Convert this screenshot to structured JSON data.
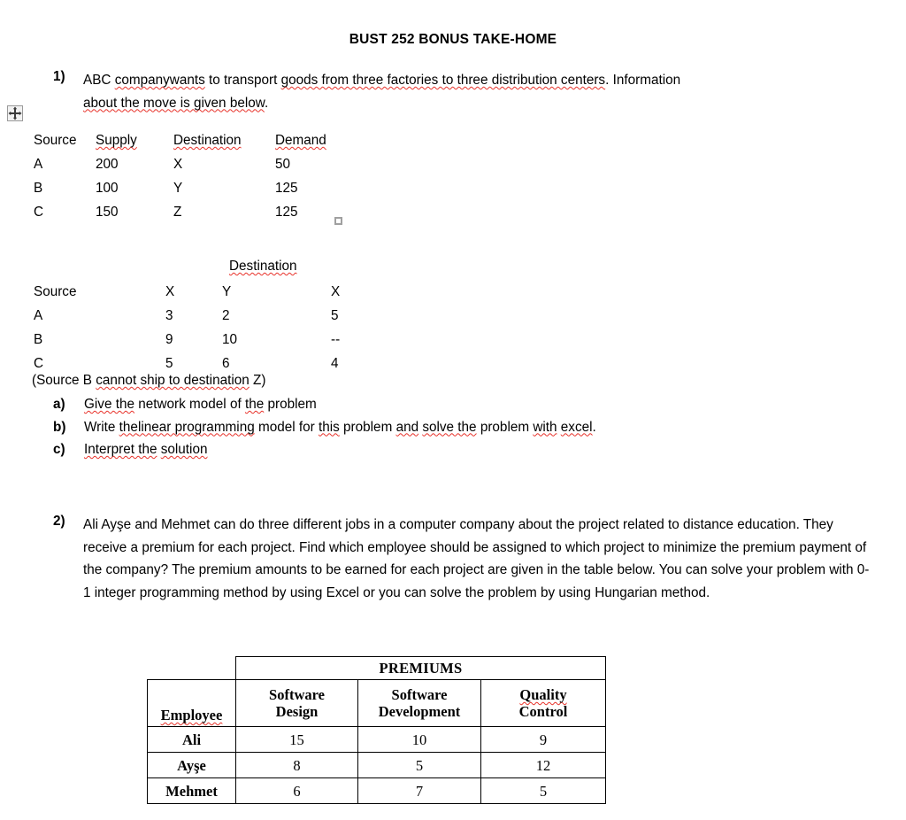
{
  "document": {
    "title": "BUST 252 BONUS TAKE-HOME"
  },
  "question1": {
    "number": "1)",
    "text_part1": "ABC ",
    "text_sp1": "company",
    "text_gap": " ",
    "text_sp2": "wants",
    "text_mid": " to transport ",
    "text_sp3": "goods from three factories to three distribution centers",
    "text_dot": ". Information",
    "line2_sp": "about the move is given below",
    "line2_end": ".",
    "supply_table": {
      "headers": [
        "Source",
        "Supply",
        "Destination",
        "Demand"
      ],
      "rows": [
        [
          "A",
          "200",
          "X",
          "50"
        ],
        [
          "B",
          "100",
          "Y",
          "125"
        ],
        [
          "C",
          "150",
          "Z",
          "125"
        ]
      ]
    },
    "cost_table": {
      "group_header": "Destination",
      "headers": [
        "Source",
        "X",
        "Y",
        "X"
      ],
      "rows": [
        [
          "A",
          "3",
          "2",
          "5"
        ],
        [
          "B",
          "9",
          "10",
          "--"
        ],
        [
          "C",
          "5",
          "6",
          "4"
        ]
      ]
    },
    "note": "(Source B cannot ship to destination Z)",
    "note_prefix": "(Source B ",
    "note_sp": "cannot ship to destination",
    "note_suffix": " Z)",
    "sub_items": [
      {
        "marker": "a)",
        "prefix": "",
        "sp1": "Give the",
        "mid": " network model of ",
        "sp2": "the",
        "suffix": " problem"
      },
      {
        "marker": "b)",
        "prefix": "Write ",
        "sp1": "the",
        "gap": " ",
        "sp2": "linear programming",
        "mid": " model for ",
        "sp3": "this",
        "mid2": " problem ",
        "sp4": "and",
        "mid3": " ",
        "sp5": "solve the",
        "mid4": " problem ",
        "sp6": "with",
        "mid5": " ",
        "sp7": "excel",
        "suffix": "."
      },
      {
        "marker": "c)",
        "prefix": "",
        "sp1": "Interpret the",
        "mid": " ",
        "sp2": "solution",
        "suffix": ""
      }
    ]
  },
  "question2": {
    "number": "2)",
    "text": "Ali Ayşe and Mehmet can do three different jobs in a computer company about the project related to distance education. They receive a premium for each project. Find which employee should be assigned to which project to minimize the premium payment of the company? The premium amounts to be earned for each project are given in the table below. You can solve your problem with 0-1 integer programming method by using Excel or you can solve the problem by using Hungarian method.",
    "premiums_table": {
      "group_title": "PREMIUMS",
      "corner_label": "Employee",
      "column_headers": [
        {
          "line1": "Software",
          "line2": "Design"
        },
        {
          "line1": "Software",
          "line2": "Development"
        },
        {
          "line1": "Quality",
          "line2": "Control",
          "spell_error_line": 1
        }
      ],
      "rows": [
        {
          "employee": "Ali",
          "values": [
            "15",
            "10",
            "9"
          ]
        },
        {
          "employee": "Ayşe",
          "values": [
            "8",
            "5",
            "12"
          ]
        },
        {
          "employee": "Mehmet",
          "values": [
            "6",
            "7",
            "5"
          ]
        }
      ]
    }
  },
  "editor_marks": {
    "move_handle": "table-move-handle",
    "resize_handle": "table-resize-handle",
    "spellcheck_color": "#e8322a",
    "grammar_color": "#2b56c6"
  }
}
